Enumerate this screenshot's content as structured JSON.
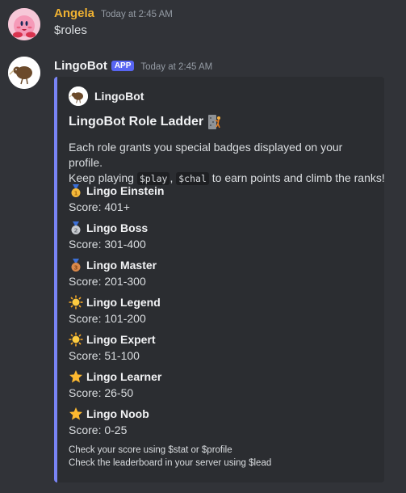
{
  "messages": [
    {
      "username": "Angela",
      "username_color": "#f0b232",
      "timestamp": "Today at 2:45 AM",
      "text": "$roles",
      "avatar_icon": "kirby-avatar"
    },
    {
      "username": "LingoBot",
      "username_color": "#f2f3f5",
      "app_tag": "APP",
      "timestamp": "Today at 2:45 AM",
      "avatar_icon": "kiwi-bird-avatar",
      "embed": {
        "accent_color": "#7984f5",
        "author": "LingoBot",
        "title": "LingoBot Role Ladder",
        "title_icon": "climbing-person-icon",
        "desc_line1": "Each role grants you special badges displayed on your profile.",
        "desc_pre": "Keep playing",
        "code1": "$play",
        "desc_sep": ",",
        "code2": "$chal",
        "desc_post": "to earn points and climb the ranks!",
        "roles": [
          {
            "icon": "gold-medal-icon",
            "name": "Lingo Einstein",
            "score": "Score: 401+"
          },
          {
            "icon": "silver-medal-icon",
            "name": "Lingo Boss",
            "score": "Score: 301-400"
          },
          {
            "icon": "bronze-medal-icon",
            "name": "Lingo Master",
            "score": "Score: 201-300"
          },
          {
            "icon": "sun-icon",
            "name": "Lingo Legend",
            "score": "Score: 101-200"
          },
          {
            "icon": "sun-icon",
            "name": "Lingo Expert",
            "score": "Score: 51-100"
          },
          {
            "icon": "star-icon",
            "name": "Lingo Learner",
            "score": "Score: 26-50"
          },
          {
            "icon": "star-icon",
            "name": "Lingo Noob",
            "score": "Score: 0-25"
          }
        ],
        "footer_line1": "Check your score using $stat or $profile",
        "footer_line2": "Check the leaderboard in your server using $lead"
      }
    }
  ]
}
